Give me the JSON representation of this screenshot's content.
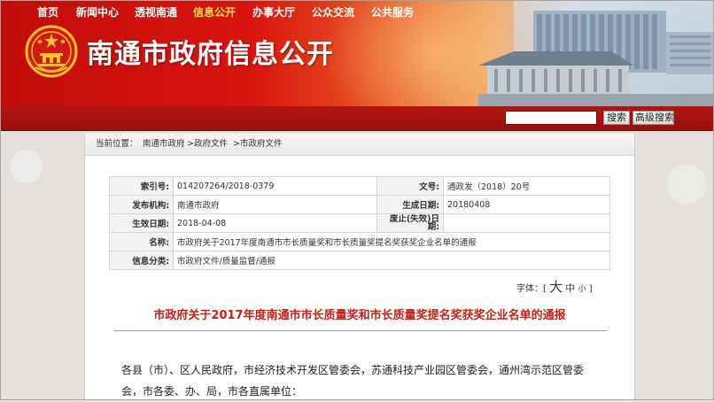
{
  "site": {
    "title": "南通市政府信息公开"
  },
  "nav": {
    "items": [
      "首页",
      "新闻中心",
      "透视南通",
      "信息公开",
      "办事大厅",
      "公众交流",
      "公共服务"
    ],
    "active_index": 3,
    "search_button": "搜索",
    "advanced_search_button": "高级搜索",
    "search_value": ""
  },
  "breadcrumb": {
    "label": "当前位置：",
    "items": [
      "南通市政府",
      ">政府文件",
      ">市政府文件"
    ]
  },
  "info": {
    "index_no_label": "索引号:",
    "index_no": "014207264/2018-0379",
    "doc_no_label": "文号:",
    "doc_no": "通政发（2018）20号",
    "issuer_label": "发布机构:",
    "issuer": "南通市政府",
    "gen_date_label": "生成日期:",
    "gen_date": "20180408",
    "effective_label": "生效日期:",
    "effective": "2018-04-08",
    "expiry_label": "废止(失效)日期:",
    "expiry": "",
    "name_label": "名称:",
    "name": "市政府关于2017年度南通市市长质量奖和市长质量奖提名奖获奖企业名单的通报",
    "category_label": "信息分类:",
    "category": "市政府文件/质量监督/通报"
  },
  "font_size": {
    "label": "字体：[",
    "big": "大",
    "mid": "中",
    "small": "小",
    "close": "]"
  },
  "document": {
    "title": "市政府关于2017年度南通市市长质量奖和市长质量奖提名奖获奖企业名单的通报",
    "body": "各县（市）、区人民政府，市经济技术开发区管委会，苏通科技产业园区管委会，通州湾示范区管委会，市各委、办、局，市各直属单位："
  },
  "colors": {
    "brand_red": "#b31512",
    "nav_active": "#ffe04a",
    "title_red": "#cc1f12"
  }
}
